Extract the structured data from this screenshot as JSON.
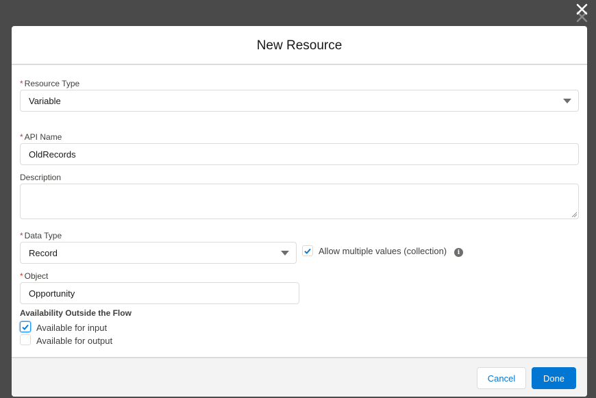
{
  "modal": {
    "title": "New Resource",
    "close_icon": "close-icon"
  },
  "fields": {
    "resource_type": {
      "label": "Resource Type",
      "required": "*",
      "value": "Variable"
    },
    "api_name": {
      "label": "API Name",
      "required": "*",
      "value": "OldRecords"
    },
    "description": {
      "label": "Description",
      "value": ""
    },
    "data_type": {
      "label": "Data Type",
      "required": "*",
      "value": "Record"
    },
    "allow_multiple": {
      "label": "Allow multiple values (collection)",
      "checked": true,
      "info_icon": "info-icon"
    },
    "object": {
      "label": "Object",
      "required": "*",
      "value": "Opportunity"
    }
  },
  "availability": {
    "title": "Availability Outside the Flow",
    "options": [
      {
        "label": "Available for input",
        "checked": true
      },
      {
        "label": "Available for output",
        "checked": false
      }
    ]
  },
  "footer": {
    "cancel_label": "Cancel",
    "done_label": "Done"
  },
  "colors": {
    "brand": "#0176d3",
    "required": "#c23934",
    "overlay": "#4a4a4a"
  }
}
